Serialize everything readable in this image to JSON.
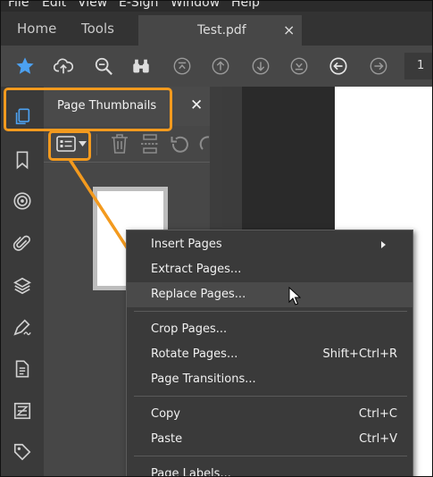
{
  "menubar": {
    "items": [
      "File",
      "Edit",
      "View",
      "E-Sign",
      "Window",
      "Help"
    ]
  },
  "tabs": {
    "home": "Home",
    "tools": "Tools",
    "document": "Test.pdf",
    "close": "×"
  },
  "toolbar": {
    "page_number": "1"
  },
  "panel": {
    "title": "Page Thumbnails",
    "close": "✕"
  },
  "context_menu": {
    "items": [
      {
        "label": "Insert Pages",
        "shortcut": ""
      },
      {
        "label": "Extract Pages...",
        "shortcut": ""
      },
      {
        "label": "Replace Pages...",
        "shortcut": ""
      },
      {
        "label": "Crop Pages...",
        "shortcut": ""
      },
      {
        "label": "Rotate Pages...",
        "shortcut": "Shift+Ctrl+R"
      },
      {
        "label": "Page Transitions...",
        "shortcut": ""
      },
      {
        "label": "Copy",
        "shortcut": "Ctrl+C"
      },
      {
        "label": "Paste",
        "shortcut": "Ctrl+V"
      },
      {
        "label": "Page Labels...",
        "shortcut": ""
      }
    ]
  },
  "colors": {
    "accent_orange": "#f39a1e",
    "accent_blue": "#4ca1f1",
    "menu_highlight": "#4a4a4a"
  }
}
